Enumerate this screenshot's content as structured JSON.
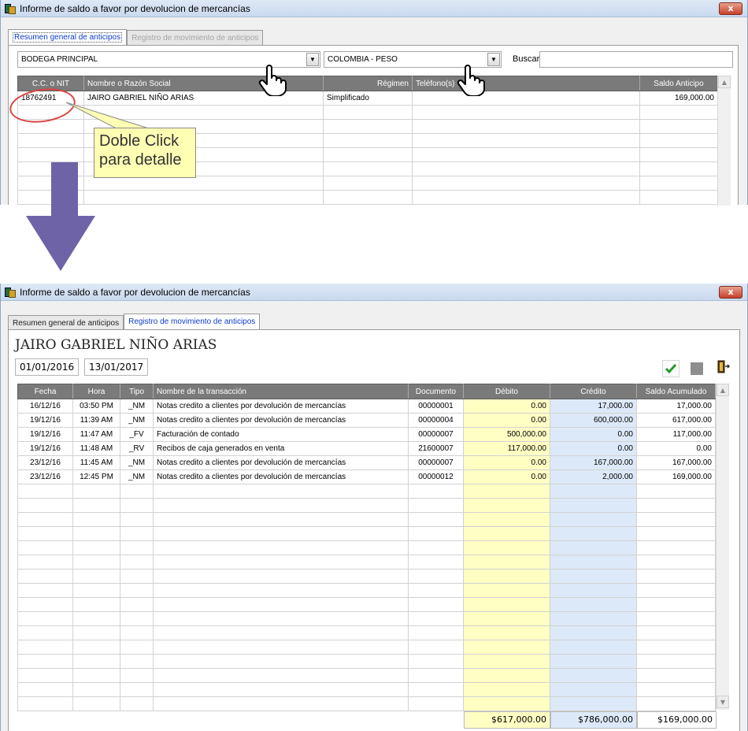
{
  "window_title": "Informe de saldo a favor por devolucion de mercancías",
  "close_label": "x",
  "tabs": {
    "summary": "Resumen general de anticipos",
    "movements": "Registro de movimiento de anticipos"
  },
  "filters": {
    "warehouse": "BODEGA PRINCIPAL",
    "currency": "COLOMBIA - PESO",
    "search_label": "Buscar",
    "search_value": ""
  },
  "summary_table": {
    "columns": [
      "C.C. o NIT",
      "Nombre o Razón Social",
      "Régimen",
      "Teléfono(s)",
      "Saldo Anticipo"
    ],
    "rows": [
      {
        "nit": "18762491",
        "name": "JAIRO GABRIEL NIÑO ARIAS",
        "regime": "Simplificado",
        "phone": "",
        "balance": "169,000.00"
      }
    ]
  },
  "callout": {
    "line1": "Doble Click",
    "line2": "para detalle"
  },
  "detail": {
    "person": "JAIRO GABRIEL NIÑO ARIAS",
    "date_from": "01/01/2016",
    "date_to": "13/01/2017",
    "columns": [
      "Fecha",
      "Hora",
      "Tipo",
      "Nombre de la transacción",
      "Documento",
      "Débito",
      "Crédito",
      "Saldo Acumulado"
    ],
    "rows": [
      {
        "fecha": "16/12/16",
        "hora": "03:50 PM",
        "tipo": "_NM",
        "nombre": "Notas credito a clientes por devolución de mercancías",
        "doc": "00000001",
        "debito": "0.00",
        "credito": "17,000.00",
        "saldo": "17,000.00"
      },
      {
        "fecha": "19/12/16",
        "hora": "11:39 AM",
        "tipo": "_NM",
        "nombre": "Notas credito a clientes por devolución de mercancías",
        "doc": "00000004",
        "debito": "0.00",
        "credito": "600,000.00",
        "saldo": "617,000.00"
      },
      {
        "fecha": "19/12/16",
        "hora": "11:47 AM",
        "tipo": "_FV",
        "nombre": "Facturación de contado",
        "doc": "00000007",
        "debito": "500,000.00",
        "credito": "0.00",
        "saldo": "117,000.00"
      },
      {
        "fecha": "19/12/16",
        "hora": "11:48 AM",
        "tipo": "_RV",
        "nombre": "Recibos de caja generados en venta",
        "doc": "21600007",
        "debito": "117,000.00",
        "credito": "0.00",
        "saldo": "0.00"
      },
      {
        "fecha": "23/12/16",
        "hora": "11:45 AM",
        "tipo": "_NM",
        "nombre": "Notas credito a clientes por devolución de mercancías",
        "doc": "00000007",
        "debito": "0.00",
        "credito": "167,000.00",
        "saldo": "167,000.00"
      },
      {
        "fecha": "23/12/16",
        "hora": "12:45 PM",
        "tipo": "_NM",
        "nombre": "Notas credito a clientes por devolución de mercancías",
        "doc": "00000012",
        "debito": "0.00",
        "credito": "2,000.00",
        "saldo": "169,000.00"
      }
    ],
    "totals": {
      "debito": "$617,000.00",
      "credito": "$786,000.00",
      "saldo": "$169,000.00"
    }
  },
  "icons": {
    "app": "app-icon",
    "confirm": "green-check-icon",
    "stop": "gray-square-icon",
    "exit": "exit-door-icon",
    "pointer": "hand-pointer-icon",
    "down_arrow": "purple-down-arrow"
  },
  "colors": {
    "debit_col": "#ffffc4",
    "credit_col": "#dce9f8",
    "header_bg": "#7a7a7a",
    "active_tab_text": "#0d3ccc",
    "arrow": "#6f63a8"
  }
}
